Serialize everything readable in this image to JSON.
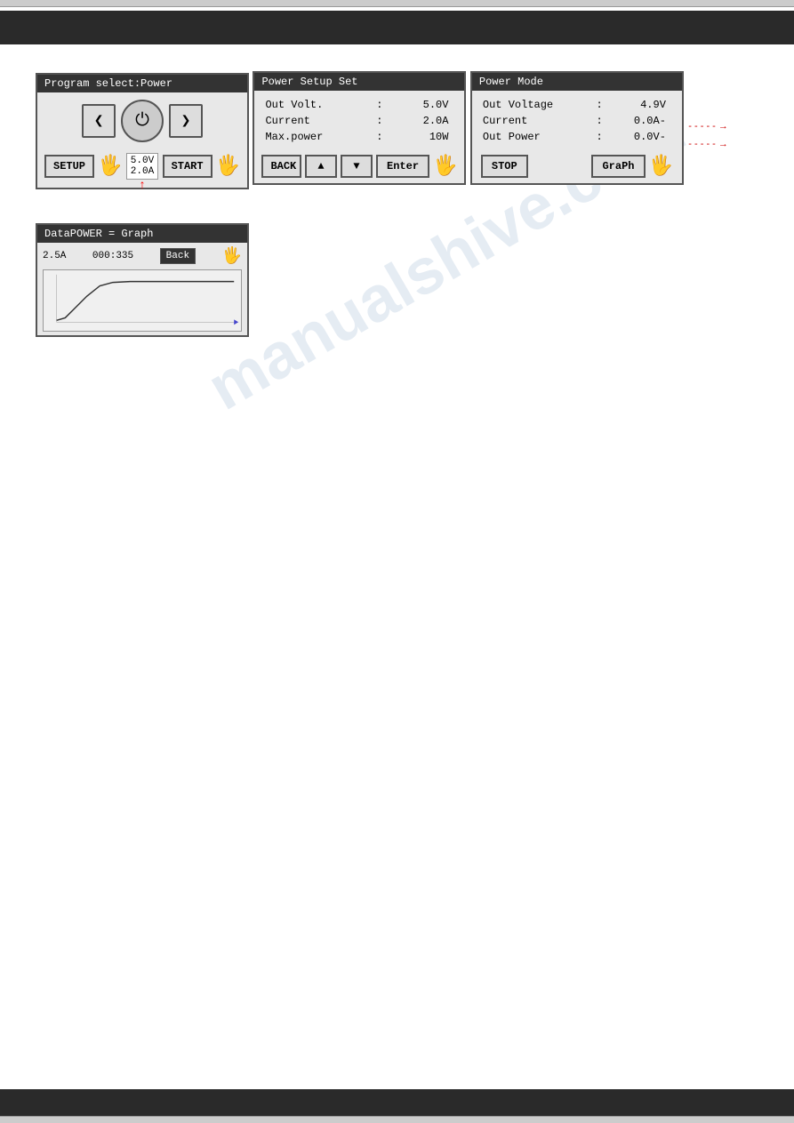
{
  "header": {
    "top_bar_color": "#cccccc",
    "header_bar_color": "#2a2a2a"
  },
  "watermark": {
    "text": "manualshive.com"
  },
  "panel1": {
    "title": "Program select:Power",
    "voltage": "5.0V",
    "current": "2.0A",
    "setup_label": "SETUP",
    "start_label": "START",
    "left_arrow": "❮",
    "right_arrow": "❯",
    "power_symbol": "⏻"
  },
  "panel2": {
    "title": "Power Setup Set",
    "rows": [
      {
        "label": "Out Volt.",
        "colon": ":",
        "value": "5.0V"
      },
      {
        "label": "Current",
        "colon": ":",
        "value": "2.0A"
      },
      {
        "label": "Max.power",
        "colon": ":",
        "value": "10W"
      }
    ],
    "back_label": "BACK",
    "up_label": "▲",
    "down_label": "▼",
    "enter_label": "Enter"
  },
  "panel3": {
    "title": "Power Mode",
    "rows": [
      {
        "label": "Out Voltage",
        "colon": ":",
        "value": "4.9V"
      },
      {
        "label": "Current",
        "colon": ":",
        "value": "0.0A-"
      },
      {
        "label": "Out Power",
        "colon": ":",
        "value": "0.0V-"
      }
    ],
    "stop_label": "STOP",
    "graph_label": "GraPh"
  },
  "panel4": {
    "title": "DataPOWER = Graph",
    "current_label": "2.5A",
    "time_label": "000:335",
    "back_label": "Back"
  }
}
